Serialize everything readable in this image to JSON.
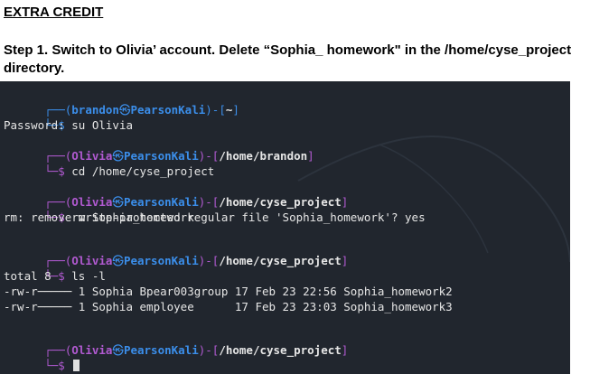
{
  "doc": {
    "heading": "EXTRA CREDIT",
    "step": "Step 1. Switch to Olivia’ account. Delete “Sophia_ homework\" in the /home/cyse_project directory."
  },
  "terminal": {
    "p1": {
      "corner": "┌──(",
      "user": "brandon",
      "skull": "㉿",
      "host": "PearsonKali",
      "mid": ")-[",
      "path": "~",
      "end": "]"
    },
    "c1": {
      "prefix": "└─$ ",
      "cmd": "su Olivia"
    },
    "pwd_prompt": "Password:",
    "p2": {
      "corner": "┌──(",
      "user": "Olivia",
      "skull": "㉿",
      "host": "PearsonKali",
      "mid": ")-[",
      "path": "/home/brandon",
      "end": "]"
    },
    "c2": {
      "prefix": "└─$ ",
      "cmd": "cd /home/cyse_project"
    },
    "p3": {
      "corner": "┌──(",
      "user": "Olivia",
      "skull": "㉿",
      "host": "PearsonKali",
      "mid": ")-[",
      "path": "/home/cyse_project",
      "end": "]"
    },
    "c3": {
      "prefix": "└─$ ",
      "cmd": "rm Sophia_homework"
    },
    "rm_msg": "rm: remove write-protected regular file 'Sophia_homework'? yes",
    "p4": {
      "corner": "┌──(",
      "user": "Olivia",
      "skull": "㉿",
      "host": "PearsonKali",
      "mid": ")-[",
      "path": "/home/cyse_project",
      "end": "]"
    },
    "c4": {
      "prefix": "└─$ ",
      "cmd": "ls -l"
    },
    "total": "total 8",
    "row1": "-rw-r───── 1 Sophia Bpear003group 17 Feb 23 22:56 Sophia_homework2",
    "row2": "-rw-r───── 1 Sophia employee      17 Feb 23 23:03 Sophia_homework3",
    "p5": {
      "corner": "┌──(",
      "user": "Olivia",
      "skull": "㉿",
      "host": "PearsonKali",
      "mid": ")-[",
      "path": "/home/cyse_project",
      "end": "]"
    },
    "c5": {
      "prefix": "└─$ "
    }
  }
}
